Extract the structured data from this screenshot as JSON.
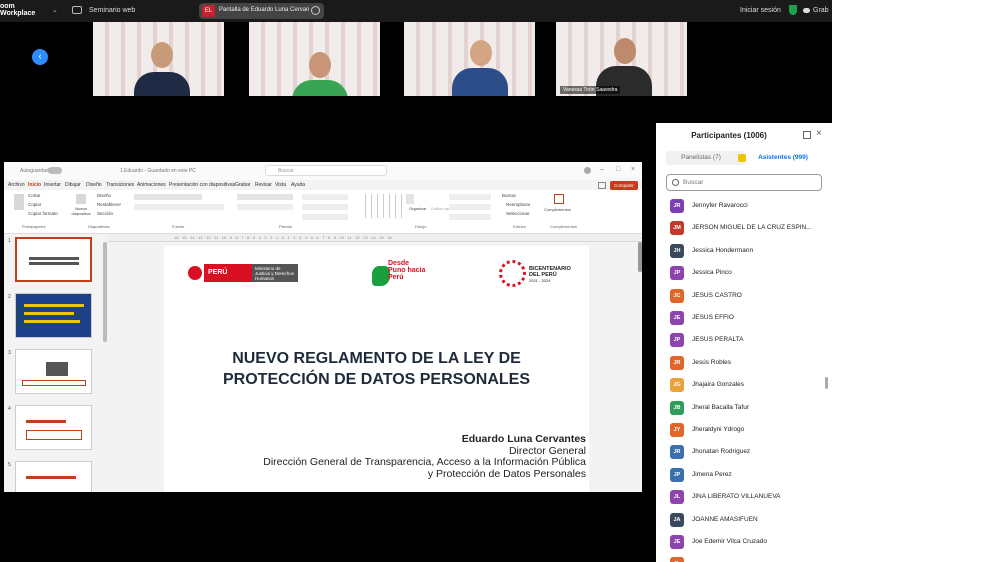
{
  "app": {
    "logo_line1": "oom",
    "logo_line2": "Workplace",
    "webinar_label": "Seminario web"
  },
  "share": {
    "badge": "EL",
    "text": "Pantalla de Eduardo Luna Cervan"
  },
  "topbar": {
    "login": "Iniciar sesión",
    "record": "Grab"
  },
  "videos": [
    {
      "name": ""
    },
    {
      "name": ""
    },
    {
      "name": ""
    },
    {
      "name": "Vanessa Tirón Saavedra"
    }
  ],
  "ppt": {
    "autosave": "Autoguardado",
    "doc_title": "1.Eduardo - Guardado en este PC",
    "search": "Buscar",
    "share_btn": "Compartir",
    "menu": [
      "Archivo",
      "Inicio",
      "Insertar",
      "Dibujar",
      "Diseño",
      "Transiciones",
      "Animaciones",
      "Presentación con diapositivas",
      "Grabar",
      "Revisar",
      "Vista",
      "Ayuda"
    ],
    "groups": [
      "Portapapeles",
      "Diapositivas",
      "Fuente",
      "Párrafo",
      "Dibujo",
      "Edición",
      "Complementos"
    ],
    "ribbon_labels": {
      "cut": "Cortar",
      "copy": "Copiar",
      "format": "Copiar formato",
      "new_slide": "Nueva diapositiva",
      "design": "Diseño",
      "reset": "Restablecer",
      "section": "Sección",
      "arrange": "Organizar",
      "quick": "Estilos rápidos",
      "find": "Buscar",
      "replace": "Reemplazar",
      "select": "Seleccionar",
      "addins": "Complementos"
    },
    "ruler_text": "16 · 15 · 14 · 13 · 12 · 11 · 10 · 9 · 8 · 7 · 6 · 5 · 4 · 3 · 2 · 1 · 0 · 1 · 2 · 3 · 4 · 5 · 6 · 7 · 8 · 9 · 10 · 11 · 12 · 13 · 14 · 15 · 16",
    "thumb_numbers": [
      "1",
      "2",
      "3",
      "4",
      "5"
    ]
  },
  "slide": {
    "peru": "PERÚ",
    "ministerio": "Ministerio de Justicia y Derechos Humanos",
    "logo2": "Desde Puno hacia Perú",
    "bicentenario": "BICENTENARIO DEL PERÚ",
    "bicentenario_years": "2021 - 2024",
    "title_line1": "NUEVO REGLAMENTO DE LA LEY DE",
    "title_line2": "PROTECCIÓN DE DATOS PERSONALES",
    "author_name": "Eduardo Luna Cervantes",
    "author_role": "Director General",
    "author_unit1": "Dirección General de Transparencia, Acceso a la Información Pública",
    "author_unit2": "y Protección de Datos Personales"
  },
  "participants": {
    "title": "Participantes (1006)",
    "tab_panelists": "Panelistas (7)",
    "tab_attendees": "Asistentes (999)",
    "search_placeholder": "Buscar",
    "list": [
      {
        "initials": "JR",
        "name": "Jennyfer Ravarocci",
        "color": "#7b3fb2"
      },
      {
        "initials": "JM",
        "name": "JERSON MIGUEL DE LA CRUZ ESPIN...",
        "color": "#c0392b"
      },
      {
        "initials": "JH",
        "name": "Jessica Hondermann",
        "color": "#3a4a5c"
      },
      {
        "initials": "JP",
        "name": "Jessica Pinco",
        "color": "#8e44ad"
      },
      {
        "initials": "JC",
        "name": "JESUS CASTRO",
        "color": "#e0662a"
      },
      {
        "initials": "JE",
        "name": "JESUS EFFIO",
        "color": "#8e44ad"
      },
      {
        "initials": "JP",
        "name": "JESUS PERALTA",
        "color": "#8e44ad"
      },
      {
        "initials": "JR",
        "name": "Jesús Robles",
        "color": "#e0662a"
      },
      {
        "initials": "JG",
        "name": "Jhajaira Gonzales",
        "color": "#e8a33a"
      },
      {
        "initials": "JB",
        "name": "Jheral Bacalla Tafur",
        "color": "#2e9c5a"
      },
      {
        "initials": "JY",
        "name": "Jheraldyni Ydrogo",
        "color": "#e0662a"
      },
      {
        "initials": "JR",
        "name": "Jhonatan Rodriguez",
        "color": "#3a6fb0"
      },
      {
        "initials": "JP",
        "name": "Jimena Perez",
        "color": "#3a6fb0"
      },
      {
        "initials": "JL",
        "name": "JINA LIBERATO VILLANUEVA",
        "color": "#8e44ad"
      },
      {
        "initials": "JA",
        "name": "JOANNE AMASIFUEN",
        "color": "#3a4a5c"
      },
      {
        "initials": "JE",
        "name": "Joe Edemir Vilca  Cruzado",
        "color": "#8e44ad"
      },
      {
        "initials": "JL",
        "name": "",
        "color": "#e0662a"
      }
    ]
  }
}
